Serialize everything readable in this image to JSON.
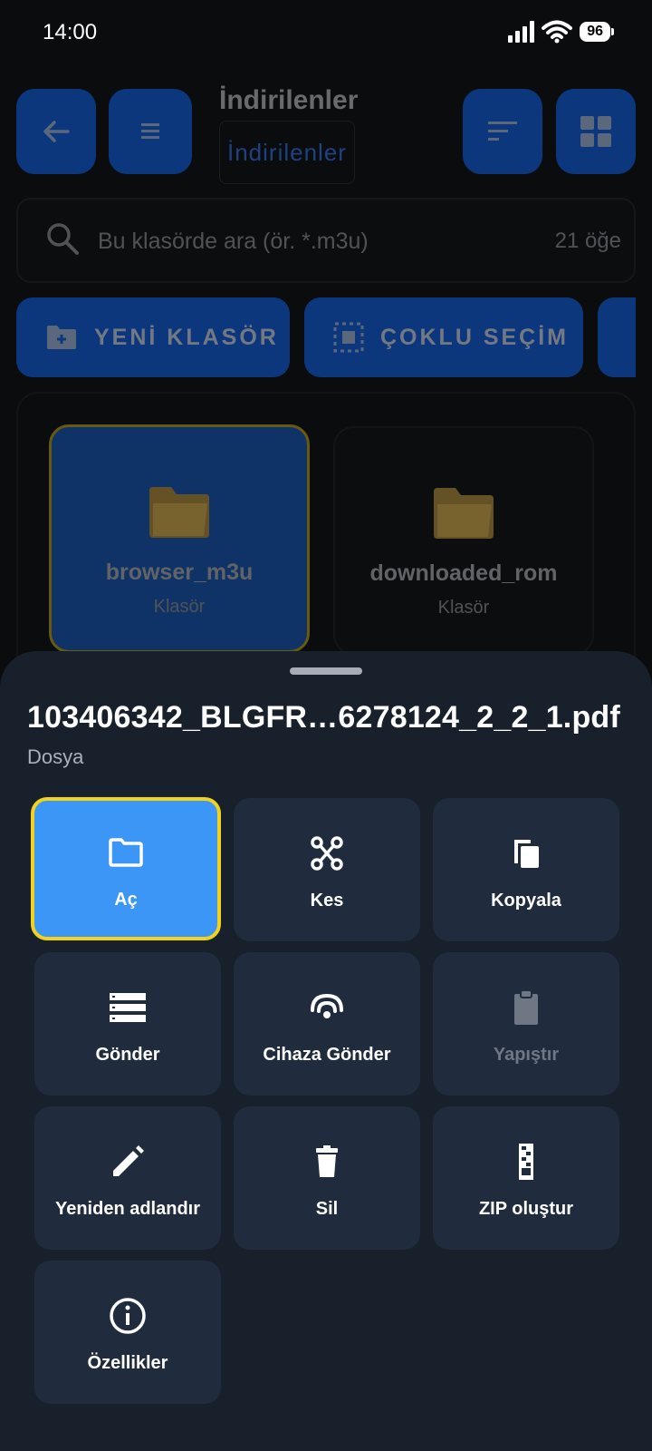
{
  "status_bar": {
    "time": "14:00",
    "battery": "96"
  },
  "header": {
    "title": "İndirilenler",
    "breadcrumb": "İndirilenler"
  },
  "search": {
    "placeholder": "Bu klasörde ara (ör. *.m3u)",
    "count": "21 öğe"
  },
  "chips": {
    "new_folder": "YENİ KLASÖR",
    "multi_select": "ÇOKLU SEÇİM"
  },
  "folders": [
    {
      "name": "browser_m3u",
      "type": "Klasör"
    },
    {
      "name": "downloaded_rom",
      "type": "Klasör"
    }
  ],
  "sheet": {
    "title": "103406342_BLGFR…6278124_2_2_1.pdf",
    "subtitle": "Dosya",
    "actions": {
      "open": "Aç",
      "cut": "Kes",
      "copy": "Kopyala",
      "send": "Gönder",
      "send_device": "Cihaza Gönder",
      "paste": "Yapıştır",
      "rename": "Yeniden adlandır",
      "delete": "Sil",
      "zip": "ZIP oluştur",
      "properties": "Özellikler"
    }
  },
  "colors": {
    "accent": "#3b96f6",
    "focus_border": "#f2d21b",
    "sheet_bg": "#18202c",
    "tile_bg": "#202c3d"
  }
}
